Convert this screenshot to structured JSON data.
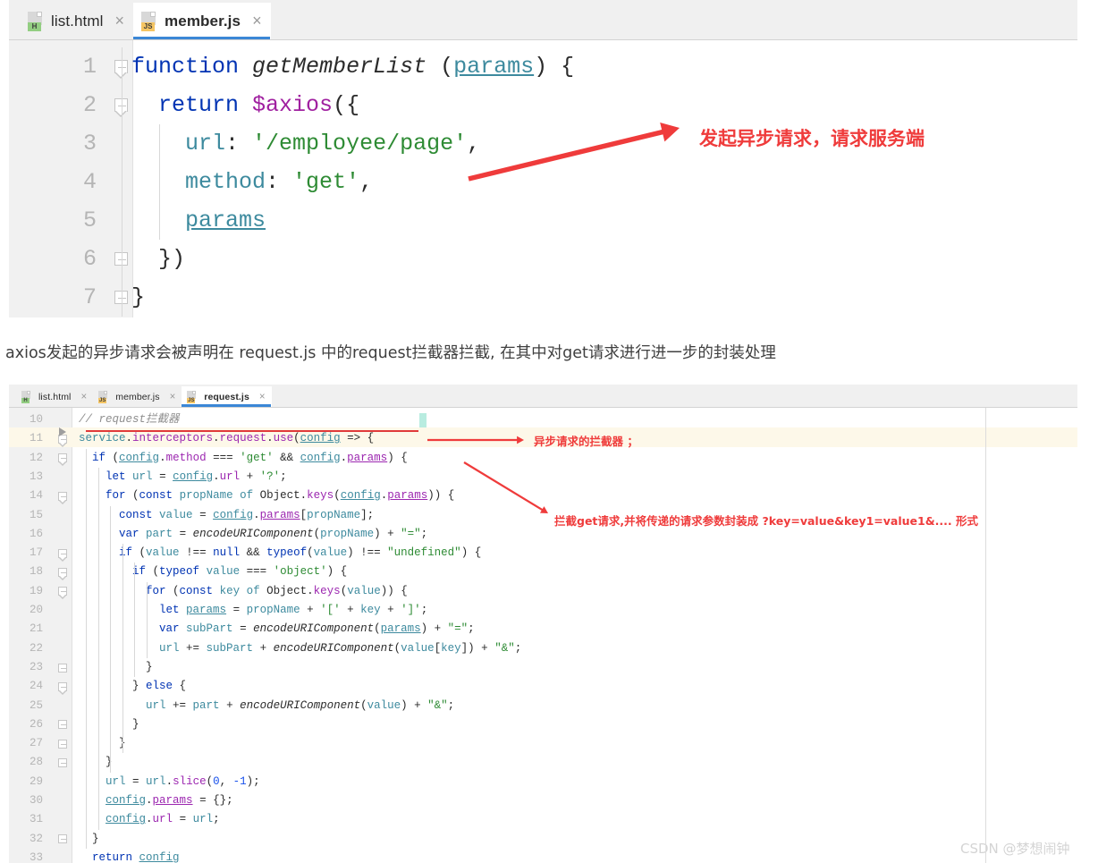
{
  "editor_top": {
    "tabs": [
      {
        "label": "list.html",
        "icon": "html-file-icon",
        "badge": "H",
        "active": false,
        "close": "×"
      },
      {
        "label": "member.js",
        "icon": "js-file-icon",
        "badge": "JS",
        "active": true,
        "close": "×"
      }
    ],
    "line_numbers": [
      "1",
      "2",
      "3",
      "4",
      "5",
      "6",
      "7"
    ],
    "code_lines": [
      "function getMemberList (params) {",
      "  return $axios({",
      "    url: '/employee/page',",
      "    method: 'get',",
      "    params",
      "  })",
      "}"
    ],
    "annotation": "发起异步请求，请求服务端"
  },
  "paragraph": "axios发起的异步请求会被声明在 request.js 中的request拦截器拦截, 在其中对get请求进行进一步的封装处理",
  "editor_bottom": {
    "tabs": [
      {
        "label": "list.html",
        "icon": "html-file-icon",
        "badge": "H",
        "active": false,
        "close": "×"
      },
      {
        "label": "member.js",
        "icon": "js-file-icon",
        "badge": "JS",
        "active": false,
        "close": "×"
      },
      {
        "label": "request.js",
        "icon": "js-file-icon",
        "badge": "JS",
        "active": true,
        "close": "×"
      }
    ],
    "line_numbers": [
      "10",
      "11",
      "12",
      "13",
      "14",
      "15",
      "16",
      "17",
      "18",
      "19",
      "20",
      "21",
      "22",
      "23",
      "24",
      "25",
      "26",
      "27",
      "28",
      "29",
      "30",
      "31",
      "32",
      "33"
    ],
    "code_lines": [
      "// request拦截器",
      "service.interceptors.request.use(config => {",
      "  if (config.method === 'get' && config.params) {",
      "    let url = config.url + '?';",
      "    for (const propName of Object.keys(config.params)) {",
      "      const value = config.params[propName];",
      "      var part = encodeURIComponent(propName) + \"=\";",
      "      if (value !== null && typeof(value) !== \"undefined\") {",
      "        if (typeof value === 'object') {",
      "          for (const key of Object.keys(value)) {",
      "            let params = propName + '[' + key + ']';",
      "            var subPart = encodeURIComponent(params) + \"=\";",
      "            url += subPart + encodeURIComponent(value[key]) + \"&\";",
      "          }",
      "        } else {",
      "          url += part + encodeURIComponent(value) + \"&\";",
      "        }",
      "      }",
      "    }",
      "    url = url.slice(0, -1);",
      "    config.params = {};",
      "    config.url = url;",
      "  }",
      "  return config"
    ],
    "annotations": [
      "异步请求的拦截器 ；",
      "拦截get请求,并将传递的请求参数封装成  ?key=value&key1=value1&.... 形式"
    ]
  },
  "watermark": "CSDN @梦想闹钟",
  "colors": {
    "annotation_red": "#ef3b3b",
    "active_tab_underline": "#3b87d6",
    "highlight_row": "#fdf8e9",
    "html_badge": "#93ce82",
    "js_badge": "#f5c563"
  }
}
